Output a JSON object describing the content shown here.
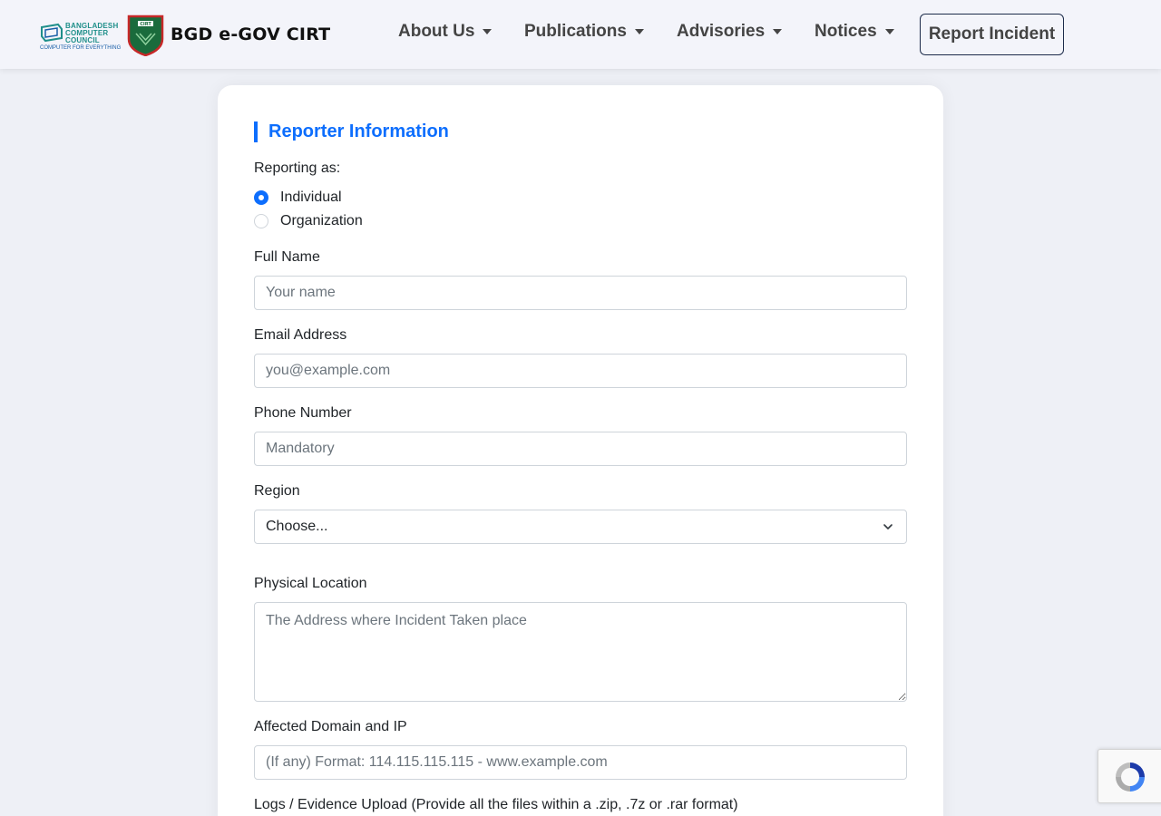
{
  "header": {
    "bcc_logo_text": "BANGLADESH COMPUTER COUNCIL",
    "bcc_tagline": "COMPUTER FOR EVERYTHING",
    "brand_name": "BGD e-GOV CIRT",
    "nav": [
      {
        "label": "About Us"
      },
      {
        "label": "Publications"
      },
      {
        "label": "Advisories"
      },
      {
        "label": "Notices"
      }
    ],
    "report_button": "Report Incident"
  },
  "form": {
    "section_title": "Reporter Information",
    "reporting_as_label": "Reporting as:",
    "reporting_options": [
      {
        "label": "Individual",
        "checked": true
      },
      {
        "label": "Organization",
        "checked": false
      }
    ],
    "full_name": {
      "label": "Full Name",
      "value": "",
      "placeholder": "Your name"
    },
    "email": {
      "label": "Email Address",
      "value": "",
      "placeholder": "you@example.com"
    },
    "phone": {
      "label": "Phone Number",
      "value": "",
      "placeholder": "Mandatory"
    },
    "region": {
      "label": "Region",
      "selected": "Choose..."
    },
    "physical_location": {
      "label": "Physical Location",
      "value": "",
      "placeholder": "The Address where Incident Taken place"
    },
    "affected_domain": {
      "label": "Affected Domain and IP",
      "value": "",
      "placeholder": "(If any) Format: 114.115.115.115 - www.example.com"
    },
    "logs_upload": {
      "label": "Logs / Evidence Upload (Provide all the files within a .zip, .7z or .rar format)"
    }
  },
  "colors": {
    "accent": "#0d6efd",
    "brand_green": "#1a6b3c",
    "brand_red": "#c62828"
  },
  "icons": [
    "bcc-logo-icon",
    "cirt-shield-icon",
    "chevron-down-icon",
    "recaptcha-icon"
  ]
}
